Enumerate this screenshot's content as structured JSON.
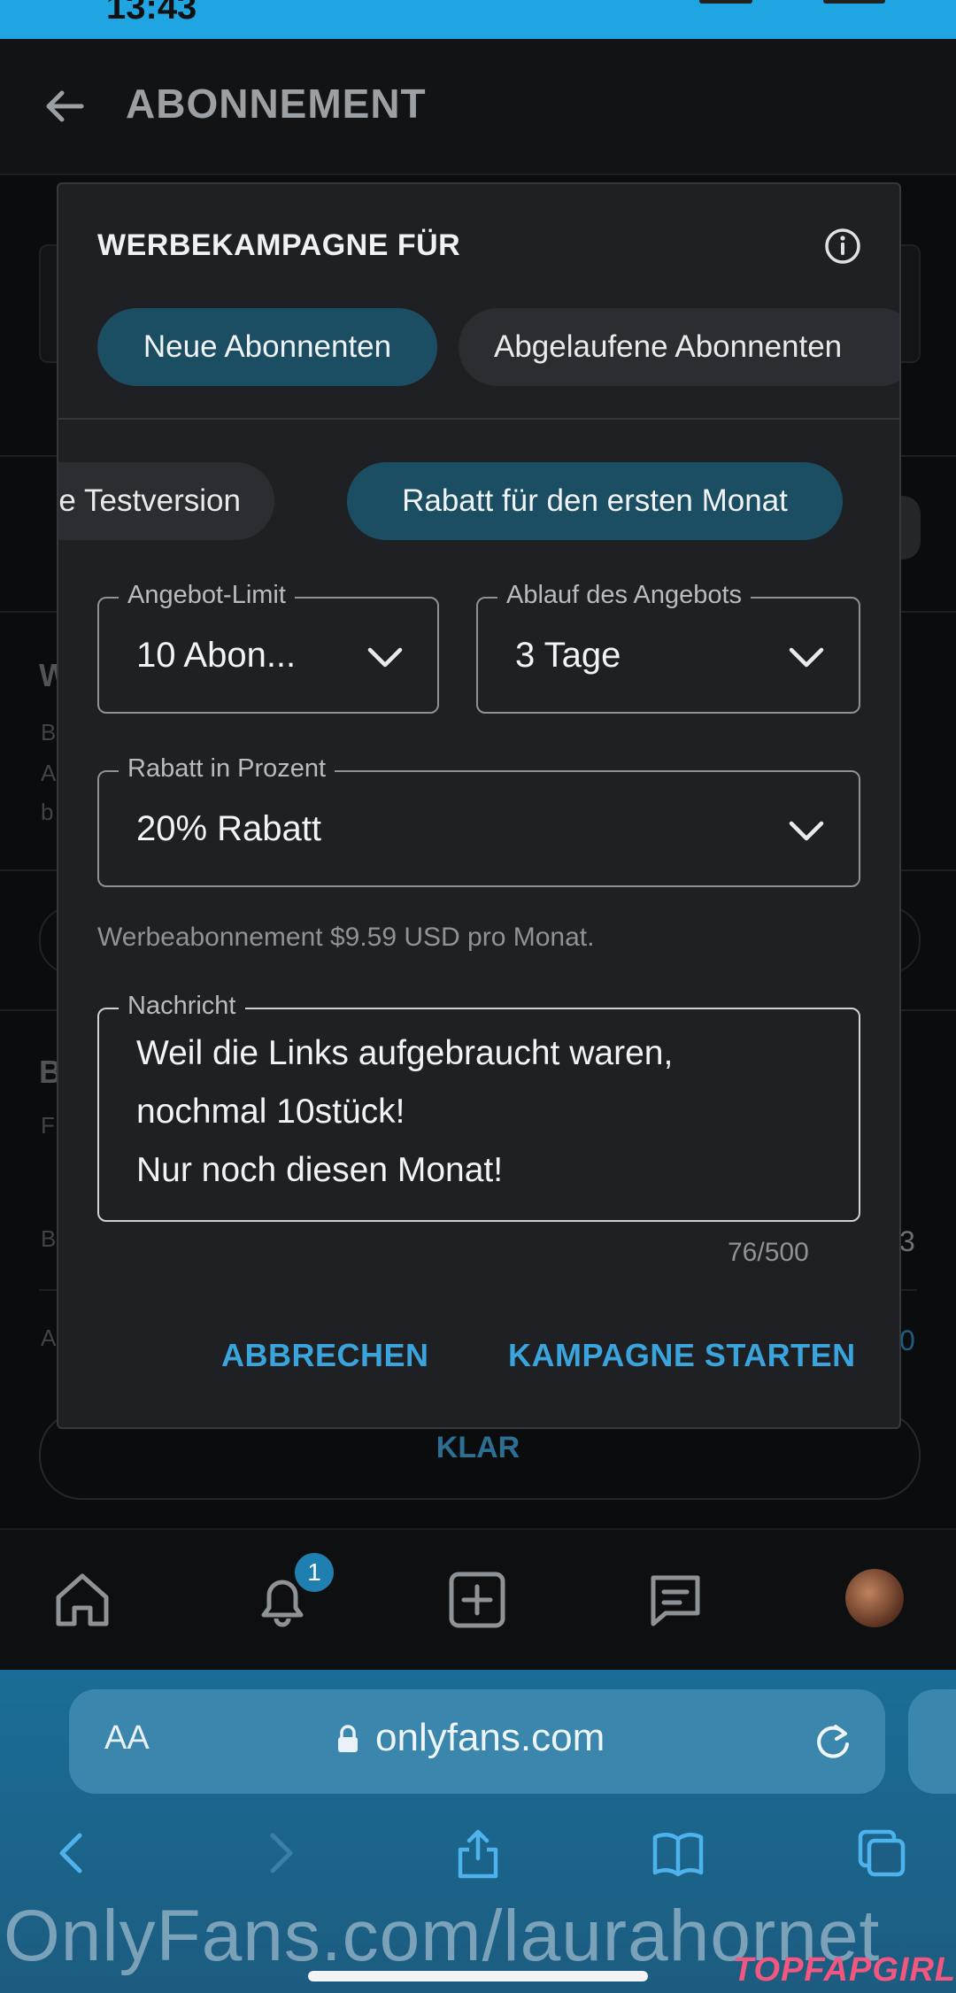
{
  "status_bar": {
    "time": "13:43"
  },
  "header": {
    "title": "ABONNEMENT"
  },
  "background": {
    "side_letters": [
      "W",
      "B",
      "A",
      "b",
      "B",
      "F",
      "B",
      "A"
    ],
    "right_fragments": [
      "3",
      "0"
    ],
    "klar_label": "KLAR"
  },
  "modal": {
    "title": "WERBEKAMPAGNE FÜR",
    "audience_chips": [
      {
        "label": "Neue Abonnenten",
        "active": true
      },
      {
        "label": "Abgelaufene Abonnenten",
        "active": false
      }
    ],
    "offer_chips": [
      {
        "label": "ose Testversion",
        "active": false
      },
      {
        "label": "Rabatt für den ersten Monat",
        "active": true
      }
    ],
    "offer_limit": {
      "label": "Angebot-Limit",
      "value": "10 Abon..."
    },
    "offer_expiry": {
      "label": "Ablauf des Angebots",
      "value": "3 Tage"
    },
    "discount": {
      "label": "Rabatt in Prozent",
      "value": "20% Rabatt"
    },
    "promo_note": "Werbeabonnement $9.59 USD pro Monat.",
    "message": {
      "label": "Nachricht",
      "lines": [
        "Weil die Links aufgebraucht waren,",
        "nochmal 10stück!",
        "Nur noch diesen Monat!"
      ],
      "char_count": "76/500"
    },
    "cancel_label": "ABBRECHEN",
    "start_label": "KAMPAGNE STARTEN"
  },
  "bottom_nav": {
    "items": [
      "home-icon",
      "bell-icon",
      "plus-square-icon",
      "message-icon",
      "avatar"
    ],
    "notification_count": "1"
  },
  "browser": {
    "text_size_label": "AA",
    "url": "onlyfans.com",
    "watermark": "OnlyFans.com/laurahornet",
    "brand_mark": "TOPFAPGIRLS"
  },
  "colors": {
    "accent": "#3aa4dd",
    "chip_active": "#1c4e63",
    "modal_bg": "#1e2023"
  }
}
